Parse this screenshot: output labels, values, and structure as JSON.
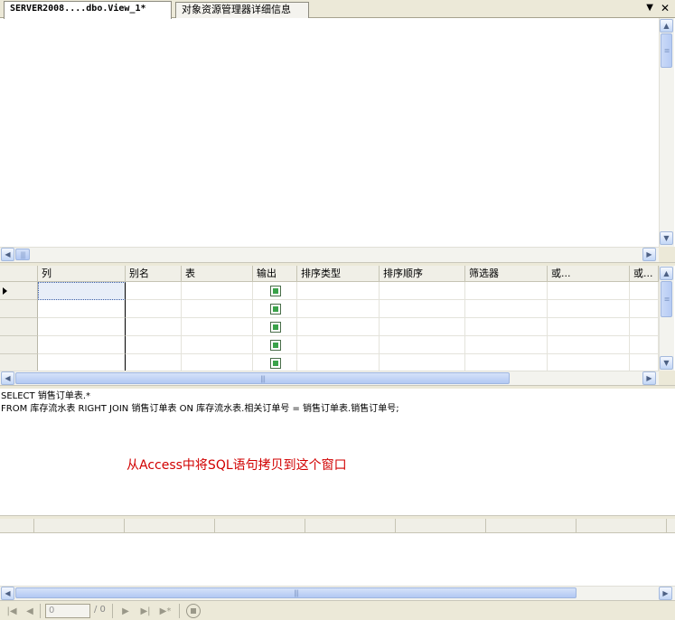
{
  "tabs": [
    {
      "label": "SERVER2008....dbo.View_1*",
      "active": true
    },
    {
      "label": "对象资源管理器详细信息",
      "active": false
    }
  ],
  "icons": {
    "tab_menu": "chevron-down-icon",
    "tab_close": "close-icon"
  },
  "grid": {
    "columns": [
      "列",
      "别名",
      "表",
      "输出",
      "排序类型",
      "排序顺序",
      "筛选器",
      "或...",
      "或..."
    ],
    "row_count": 5
  },
  "sql": {
    "lines": [
      "SELECT 销售订单表.*",
      "FROM 库存流水表 RIGHT JOIN 销售订单表 ON 库存流水表.相关订单号 = 销售订单表.销售订单号;"
    ]
  },
  "annotation": "从Access中将SQL语句拷贝到这个窗口",
  "annotation_color": "#d10000",
  "navigation": {
    "current": "0",
    "total": "/ 0"
  }
}
